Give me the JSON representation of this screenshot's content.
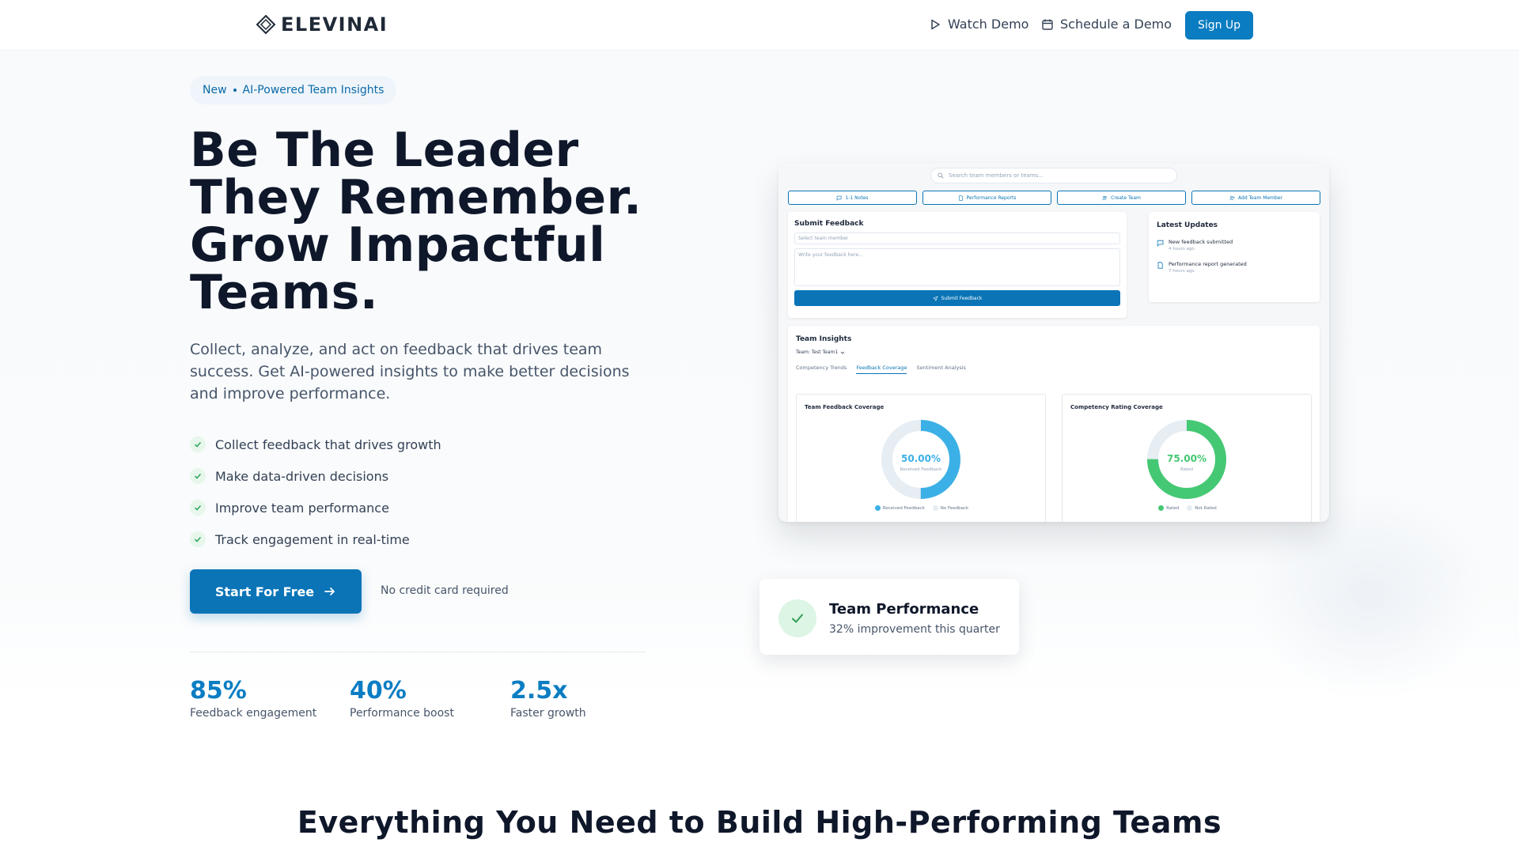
{
  "nav": {
    "brand": "ELEVINAI",
    "watch_demo": "Watch Demo",
    "schedule_demo": "Schedule a Demo",
    "sign_up": "Sign Up"
  },
  "hero": {
    "badge_new": "New",
    "badge_text": "AI-Powered Team Insights",
    "headline": [
      "Be The Leader",
      "They Remember.",
      "Grow Impactful",
      "Teams."
    ],
    "subtext": "Collect, analyze, and act on feedback that drives team success. Get AI-powered insights to make better decisions and improve performance.",
    "features": [
      "Collect feedback that drives growth",
      "Make data-driven decisions",
      "Improve team performance",
      "Track engagement in real-time"
    ],
    "cta": "Start For Free",
    "no_card": "No credit card required",
    "stats": [
      {
        "value": "85%",
        "label": "Feedback engagement"
      },
      {
        "value": "40%",
        "label": "Performance boost"
      },
      {
        "value": "2.5x",
        "label": "Faster growth"
      }
    ]
  },
  "dashboard": {
    "search_placeholder": "Search team members or teams...",
    "actions": [
      "1-1 Notes",
      "Performance Reports",
      "Create Team",
      "Add Team Member"
    ],
    "submit_feedback": {
      "title": "Submit Feedback",
      "select_placeholder": "Select team member",
      "textarea_placeholder": "Write your feedback here...",
      "button": "Submit Feedback"
    },
    "updates": {
      "title": "Latest Updates",
      "items": [
        {
          "title": "New feedback submitted",
          "time": "4 hours ago"
        },
        {
          "title": "Performance report generated",
          "time": "7 hours ago"
        }
      ]
    },
    "insights": {
      "title": "Team Insights",
      "team_select": "Team: Test Team1",
      "tabs": [
        "Competency Trends",
        "Feedback Coverage",
        "Sentiment Analysis"
      ],
      "active_tab": "Feedback Coverage",
      "charts": [
        {
          "title": "Team Feedback Coverage",
          "value_label": "50.00%",
          "value": 50,
          "sub": "Received Feedback",
          "color": "#3bb0e6",
          "track": "#e6edf3",
          "legend": [
            "Received Feedback",
            "No Feedback"
          ]
        },
        {
          "title": "Competency Rating Coverage",
          "value_label": "75.00%",
          "value": 75,
          "sub": "Rated",
          "color": "#45c873",
          "track": "#e6edf3",
          "legend": [
            "Rated",
            "Not Rated"
          ]
        }
      ]
    }
  },
  "perf_card": {
    "title": "Team Performance",
    "subtitle": "32% improvement this quarter"
  },
  "section": {
    "title": "Everything You Need to Build High-Performing Teams"
  },
  "colors": {
    "primary": "#0a74b7",
    "stat_blue": "#0b7dc3",
    "success": "#45c873"
  }
}
